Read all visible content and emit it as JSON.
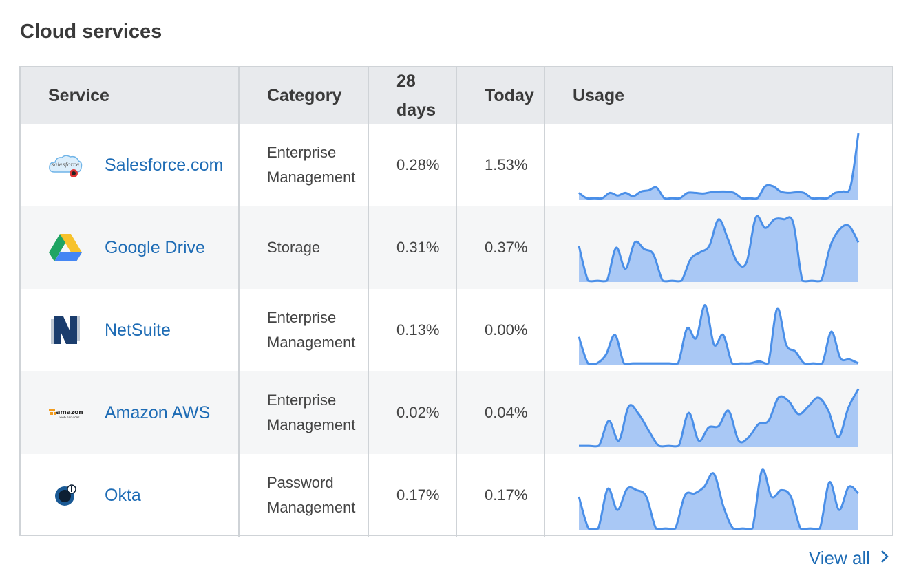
{
  "title": "Cloud services",
  "headers": {
    "service": "Service",
    "category": "Category",
    "days28_line1": "28",
    "days28_line2": "days",
    "today": "Today",
    "usage": "Usage"
  },
  "colors": {
    "accent": "#1e6cb5",
    "spark_stroke": "#4a8fe8",
    "spark_fill": "#a9c8f5"
  },
  "rows": [
    {
      "service": "Salesforce.com",
      "icon": "salesforce-logo",
      "category_line1": "Enterprise",
      "category_line2": "Management",
      "days28": "0.28%",
      "today": "1.53%",
      "usage": [
        0.1,
        0.02,
        0.02,
        0.02,
        0.1,
        0.06,
        0.1,
        0.05,
        0.12,
        0.14,
        0.18,
        0.02,
        0.02,
        0.02,
        0.1,
        0.1,
        0.09,
        0.11,
        0.12,
        0.12,
        0.1,
        0.02,
        0.02,
        0.02,
        0.2,
        0.2,
        0.12,
        0.1,
        0.11,
        0.1,
        0.02,
        0.02,
        0.02,
        0.1,
        0.12,
        0.2,
        1.0
      ]
    },
    {
      "service": "Google Drive",
      "icon": "google-drive-logo",
      "category_line1": "Storage",
      "category_line2": "",
      "days28": "0.31%",
      "today": "0.37%",
      "usage": [
        0.55,
        0.02,
        0.02,
        0.02,
        0.52,
        0.2,
        0.6,
        0.5,
        0.42,
        0.02,
        0.02,
        0.02,
        0.35,
        0.45,
        0.55,
        0.95,
        0.65,
        0.3,
        0.3,
        0.98,
        0.82,
        0.95,
        0.95,
        0.9,
        0.02,
        0.02,
        0.02,
        0.55,
        0.8,
        0.85,
        0.6
      ]
    },
    {
      "service": "NetSuite",
      "icon": "netsuite-logo",
      "category_line1": "Enterprise",
      "category_line2": "Management",
      "days28": "0.13%",
      "today": "0.00%",
      "usage": [
        0.42,
        0.02,
        0.02,
        0.15,
        0.45,
        0.02,
        0.02,
        0.02,
        0.02,
        0.02,
        0.02,
        0.02,
        0.55,
        0.4,
        0.9,
        0.3,
        0.45,
        0.02,
        0.02,
        0.02,
        0.05,
        0.02,
        0.85,
        0.3,
        0.2,
        0.02,
        0.02,
        0.02,
        0.5,
        0.1,
        0.08,
        0.02
      ]
    },
    {
      "service": "Amazon AWS",
      "icon": "amazon-aws-logo",
      "category_line1": "Enterprise",
      "category_line2": "Management",
      "days28": "0.02%",
      "today": "0.04%",
      "usage": [
        0.02,
        0.02,
        0.02,
        0.4,
        0.1,
        0.62,
        0.5,
        0.25,
        0.02,
        0.02,
        0.02,
        0.52,
        0.1,
        0.3,
        0.32,
        0.55,
        0.1,
        0.15,
        0.35,
        0.4,
        0.75,
        0.7,
        0.5,
        0.62,
        0.75,
        0.55,
        0.15,
        0.6,
        0.88
      ]
    },
    {
      "service": "Okta",
      "icon": "okta-logo",
      "category_line1": "Password",
      "category_line2": "Management",
      "days28": "0.17%",
      "today": "0.17%",
      "usage": [
        0.5,
        0.02,
        0.02,
        0.62,
        0.3,
        0.62,
        0.6,
        0.5,
        0.02,
        0.02,
        0.02,
        0.52,
        0.55,
        0.65,
        0.85,
        0.35,
        0.02,
        0.02,
        0.02,
        0.9,
        0.5,
        0.6,
        0.5,
        0.02,
        0.02,
        0.02,
        0.72,
        0.3,
        0.65,
        0.55
      ]
    }
  ],
  "footer": {
    "view_all": "View all"
  }
}
